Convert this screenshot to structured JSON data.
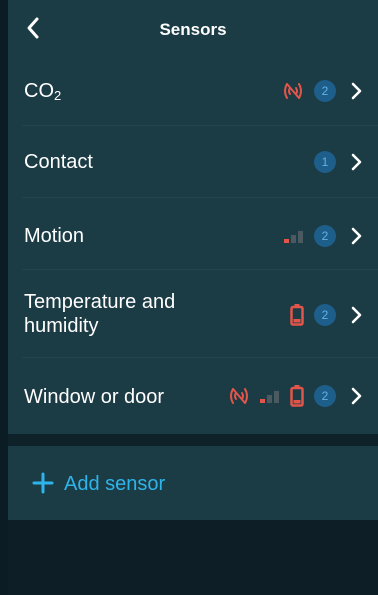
{
  "header": {
    "title": "Sensors"
  },
  "sensors": [
    {
      "name": "CO",
      "subscript": "2",
      "count": "2",
      "icons": [
        "no-signal-icon"
      ]
    },
    {
      "name": "Contact",
      "count": "1",
      "icons": []
    },
    {
      "name": "Motion",
      "count": "2",
      "icons": [
        "weak-signal-icon"
      ]
    },
    {
      "name_line1": "Temperature and",
      "name_line2": "humidity",
      "count": "2",
      "icons": [
        "low-battery-icon"
      ]
    },
    {
      "name": "Window or door",
      "count": "2",
      "icons": [
        "no-signal-icon",
        "weak-signal-icon",
        "low-battery-icon"
      ]
    }
  ],
  "add_sensor": {
    "label": "Add sensor"
  },
  "colors": {
    "accent": "#2fb4ea",
    "warning": "#e2554a",
    "background": "#1b3b45",
    "badge": "#1e5e8a"
  }
}
